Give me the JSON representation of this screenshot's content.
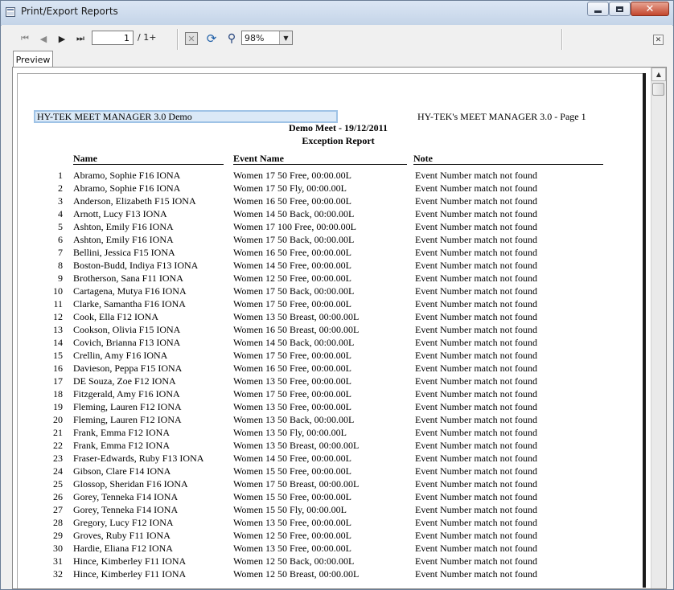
{
  "window": {
    "title": "Print/Export Reports"
  },
  "toolbar": {
    "current_page": "1",
    "page_total": "/ 1+",
    "zoom": "98%"
  },
  "tabs": [
    {
      "label": "Preview"
    }
  ],
  "report": {
    "header_left": "HY-TEK MEET MANAGER 3.0 Demo",
    "header_right": "HY-TEK's MEET MANAGER 3.0 - Page 1",
    "meet": "Demo Meet - 19/12/2011",
    "title": "Exception Report",
    "columns": {
      "name": "Name",
      "event": "Event Name",
      "note": "Note"
    },
    "rows": [
      {
        "num": "1",
        "name": "Abramo, Sophie F16 IONA",
        "event": "Women 17 50 Free, 00:00.00L",
        "note": "Event Number match not found"
      },
      {
        "num": "2",
        "name": "Abramo, Sophie F16 IONA",
        "event": "Women 17 50 Fly, 00:00.00L",
        "note": "Event Number match not found"
      },
      {
        "num": "3",
        "name": "Anderson, Elizabeth F15 IONA",
        "event": "Women 16 50 Free, 00:00.00L",
        "note": "Event Number match not found"
      },
      {
        "num": "4",
        "name": "Arnott, Lucy F13 IONA",
        "event": "Women 14 50 Back, 00:00.00L",
        "note": "Event Number match not found"
      },
      {
        "num": "5",
        "name": "Ashton, Emily F16 IONA",
        "event": "Women 17 100 Free, 00:00.00L",
        "note": "Event Number match not found"
      },
      {
        "num": "6",
        "name": "Ashton, Emily F16 IONA",
        "event": "Women 17 50 Back, 00:00.00L",
        "note": "Event Number match not found"
      },
      {
        "num": "7",
        "name": "Bellini, Jessica F15 IONA",
        "event": "Women 16 50 Free, 00:00.00L",
        "note": "Event Number match not found"
      },
      {
        "num": "8",
        "name": "Boston-Budd, Indiya F13 IONA",
        "event": "Women 14 50 Free, 00:00.00L",
        "note": "Event Number match not found"
      },
      {
        "num": "9",
        "name": "Brotherson, Sana F11 IONA",
        "event": "Women 12 50 Free, 00:00.00L",
        "note": "Event Number match not found"
      },
      {
        "num": "10",
        "name": "Cartagena, Mutya F16 IONA",
        "event": "Women 17 50 Back, 00:00.00L",
        "note": "Event Number match not found"
      },
      {
        "num": "11",
        "name": "Clarke, Samantha F16 IONA",
        "event": "Women 17 50 Free, 00:00.00L",
        "note": "Event Number match not found"
      },
      {
        "num": "12",
        "name": "Cook, Ella F12 IONA",
        "event": "Women 13 50 Breast, 00:00.00L",
        "note": "Event Number match not found"
      },
      {
        "num": "13",
        "name": "Cookson, Olivia F15 IONA",
        "event": "Women 16 50 Breast, 00:00.00L",
        "note": "Event Number match not found"
      },
      {
        "num": "14",
        "name": "Covich, Brianna F13 IONA",
        "event": "Women 14 50 Back, 00:00.00L",
        "note": "Event Number match not found"
      },
      {
        "num": "15",
        "name": "Crellin, Amy F16 IONA",
        "event": "Women 17 50 Free, 00:00.00L",
        "note": "Event Number match not found"
      },
      {
        "num": "16",
        "name": "Davieson, Peppa F15 IONA",
        "event": "Women 16 50 Free, 00:00.00L",
        "note": "Event Number match not found"
      },
      {
        "num": "17",
        "name": "DE Souza, Zoe F12 IONA",
        "event": "Women 13 50 Free, 00:00.00L",
        "note": "Event Number match not found"
      },
      {
        "num": "18",
        "name": "Fitzgerald, Amy F16 IONA",
        "event": "Women 17 50 Free, 00:00.00L",
        "note": "Event Number match not found"
      },
      {
        "num": "19",
        "name": "Fleming, Lauren F12 IONA",
        "event": "Women 13 50 Free, 00:00.00L",
        "note": "Event Number match not found"
      },
      {
        "num": "20",
        "name": "Fleming, Lauren F12 IONA",
        "event": "Women 13 50 Back, 00:00.00L",
        "note": "Event Number match not found"
      },
      {
        "num": "21",
        "name": "Frank, Emma F12 IONA",
        "event": "Women 13 50 Fly, 00:00.00L",
        "note": "Event Number match not found"
      },
      {
        "num": "22",
        "name": "Frank, Emma F12 IONA",
        "event": "Women 13 50 Breast, 00:00.00L",
        "note": "Event Number match not found"
      },
      {
        "num": "23",
        "name": "Fraser-Edwards, Ruby F13 IONA",
        "event": "Women 14 50 Free, 00:00.00L",
        "note": "Event Number match not found"
      },
      {
        "num": "24",
        "name": "Gibson, Clare F14 IONA",
        "event": "Women 15 50 Free, 00:00.00L",
        "note": "Event Number match not found"
      },
      {
        "num": "25",
        "name": "Glossop, Sheridan F16 IONA",
        "event": "Women 17 50 Breast, 00:00.00L",
        "note": "Event Number match not found"
      },
      {
        "num": "26",
        "name": "Gorey, Tenneka F14 IONA",
        "event": "Women 15 50 Free, 00:00.00L",
        "note": "Event Number match not found"
      },
      {
        "num": "27",
        "name": "Gorey, Tenneka F14 IONA",
        "event": "Women 15 50 Fly, 00:00.00L",
        "note": "Event Number match not found"
      },
      {
        "num": "28",
        "name": "Gregory, Lucy F12 IONA",
        "event": "Women 13 50 Free, 00:00.00L",
        "note": "Event Number match not found"
      },
      {
        "num": "29",
        "name": "Groves, Ruby F11 IONA",
        "event": "Women 12 50 Free, 00:00.00L",
        "note": "Event Number match not found"
      },
      {
        "num": "30",
        "name": "Hardie, Eliana F12 IONA",
        "event": "Women 13 50 Free, 00:00.00L",
        "note": "Event Number match not found"
      },
      {
        "num": "31",
        "name": "Hince, Kimberley F11 IONA",
        "event": "Women 12 50 Back, 00:00.00L",
        "note": "Event Number match not found"
      },
      {
        "num": "32",
        "name": "Hince, Kimberley F11 IONA",
        "event": "Women 12 50 Breast, 00:00.00L",
        "note": "Event Number match not found"
      }
    ]
  }
}
